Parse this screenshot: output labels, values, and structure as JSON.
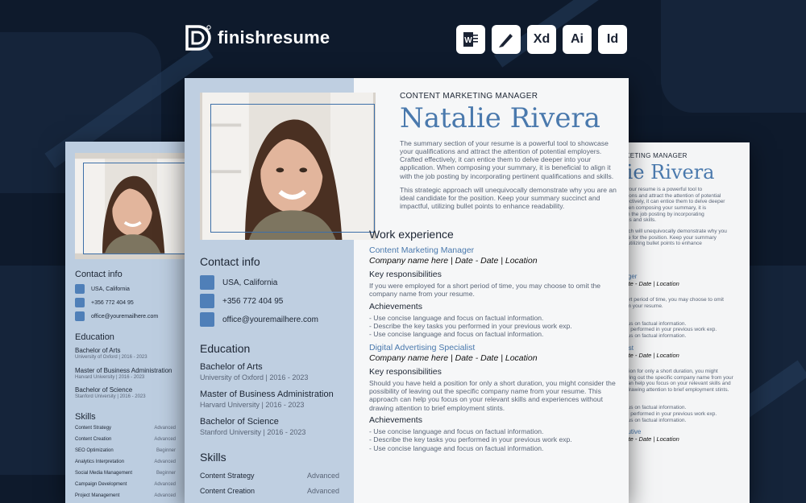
{
  "brand": {
    "name": "finishresume"
  },
  "formats": [
    {
      "label": "W",
      "icon": "word-icon"
    },
    {
      "label": "✎",
      "icon": "pen-icon"
    },
    {
      "label": "Xd",
      "icon": "xd-icon"
    },
    {
      "label": "Ai",
      "icon": "illustrator-icon"
    },
    {
      "label": "Id",
      "icon": "indesign-icon"
    }
  ],
  "resume": {
    "kicker": "CONTENT MARKETING MANAGER",
    "name": "Natalie Rivera",
    "summary1": "The summary section of your resume is a powerful tool to showcase your qualifications and attract the attention of potential employers. Crafted effectively, it can entice them to delve deeper into your application. When composing your summary, it is beneficial to align it with the job posting by incorporating pertinent qualifications and skills.",
    "summary2": "This strategic approach will unequivocally demonstrate why you are an ideal candidate for the position. Keep your summary succinct and impactful, utilizing bullet points to enhance readability.",
    "contact_title": "Contact info",
    "contacts": [
      "USA, California",
      "+356 772 404 95",
      "office@youremailhere.com"
    ],
    "education_title": "Education",
    "education": [
      {
        "degree": "Bachelor of Arts",
        "school": "University of Oxford | 2016 - 2023"
      },
      {
        "degree": "Master of Business Administration",
        "school": "Harvard University | 2016 - 2023"
      },
      {
        "degree": "Bachelor of Science",
        "school": "Stanford University | 2016 - 2023"
      }
    ],
    "skills_title": "Skills",
    "skills": [
      {
        "name": "Content Strategy",
        "level": "Advanced"
      },
      {
        "name": "Content Creation",
        "level": "Advanced"
      },
      {
        "name": "SEO Optimization",
        "level": "Beginner"
      },
      {
        "name": "Analytics Interpretation",
        "level": "Advanced"
      },
      {
        "name": "Social Media Management",
        "level": "Beginner"
      },
      {
        "name": "Campaign Development",
        "level": "Advanced"
      },
      {
        "name": "Project Management",
        "level": "Advanced"
      }
    ],
    "work_title": "Work experience",
    "jobs": [
      {
        "title": "Content Marketing Manager",
        "sub": "Company name here | Date - Date | Location",
        "resp_title": "Key responsibilities",
        "resp": "If you were employed for a short period of time, you may choose to omit the company name from your resume.",
        "ach_title": "Achievements",
        "ach": [
          "- Use concise language and focus on factual information.",
          "- Describe the key tasks you performed in your previous work exp.",
          "- Use concise language and focus on factual information."
        ]
      },
      {
        "title": "Digital Advertising Specialist",
        "sub": "Company name here | Date - Date | Location",
        "resp_title": "Key responsibilities",
        "resp": "Should you have held a position for only a short duration, you might consider the possibility of leaving out the specific company name from your resume. This approach can help you focus on your relevant skills and experiences without drawing attention to brief employment stints.",
        "ach_title": "Achievements",
        "ach": [
          "- Use concise language and focus on factual information.",
          "- Describe the key tasks you performed in your previous work exp.",
          "- Use concise language and focus on factual information."
        ]
      }
    ]
  },
  "right_page": {
    "kicker": "RKETING MANAGER",
    "name": "lie Rivera",
    "sum1": [
      "of your resume is a powerful tool to",
      "cations and attract the attention of potential",
      "effectively, it can entice them to delve deeper",
      "When composing your summary, it is",
      "with the job posting by incorporating",
      "tions and skills."
    ],
    "sum2": [
      "roach will unequivocally demonstrate why you",
      "date for the position. Keep your summary",
      "ul, utilizing bullet points to enhance"
    ],
    "j1_title": "nager",
    "j1_sub": "Date - Date | Location",
    "j1_resp": [
      "short period of time, you may choose to omit",
      "from your resume."
    ],
    "j1_ach": [
      "focus on factual information.",
      "you performed in your previous work exp.",
      "focus on factual information."
    ],
    "j2_title": "ialist",
    "j2_sub": "Date - Date | Location",
    "j2_resp": [
      "osition for only a short duration, you might",
      "eaving out the specific company name from your",
      "h can help you focus on your relevant skills and",
      "ut drawing attention to brief employment stints."
    ],
    "j2_ach": [
      "focus on factual information.",
      "you performed in your previous work exp.",
      "focus on factual information."
    ],
    "j3_title": "ecutive",
    "j3_sub": "Date - Date | Location"
  }
}
